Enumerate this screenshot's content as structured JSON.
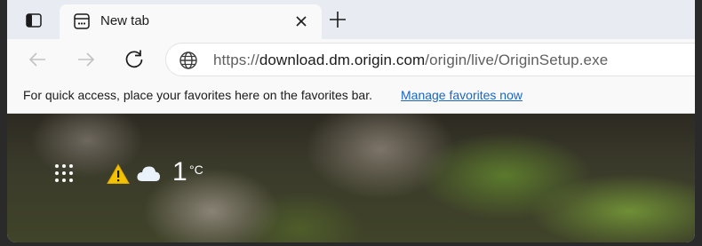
{
  "tabs": [
    {
      "title": "New tab"
    }
  ],
  "address_bar": {
    "url_prefix": "https://",
    "url_host": "download.dm.origin.com",
    "url_path": "/origin/live/OriginSetup.exe"
  },
  "favorites_bar": {
    "message": "For quick access, place your favorites here on the favorites bar.",
    "manage_link": "Manage favorites now"
  },
  "weather": {
    "temperature": "1",
    "unit": "°C",
    "icons": [
      "warning-icon",
      "cloud-icon"
    ]
  },
  "icons": {
    "tab_actions": "tab-actions-icon",
    "tab_favicon": "new-tab-page-icon",
    "tab_close": "close-icon",
    "new_tab": "plus-icon",
    "back": "back-arrow-icon",
    "forward": "forward-arrow-icon",
    "refresh": "refresh-icon",
    "site_info": "globe-icon",
    "apps": "app-launcher-icon"
  },
  "colors": {
    "link": "#1a66c2",
    "tabstrip": "#e8ecf2",
    "toolbar": "#f9f9f9"
  }
}
